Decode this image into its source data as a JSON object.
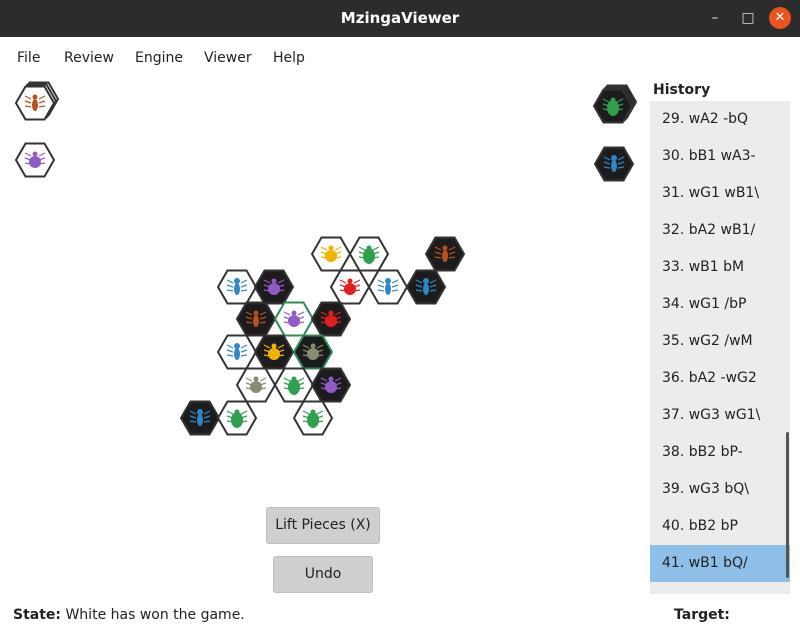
{
  "window": {
    "title": "MzingaViewer",
    "minimize": "–",
    "maximize": "□",
    "close": "✕"
  },
  "menu": [
    "File",
    "Review",
    "Engine",
    "Viewer",
    "Help"
  ],
  "history": {
    "title": "History",
    "moves": [
      "29. wA2 -bQ",
      "30. bB1 wA3-",
      "31. wG1 wB1\\",
      "32. bA2 wB1/",
      "33. wB1 bM",
      "34. wG1 /bP",
      "35. wG2 /wM",
      "36. bA2 -wG2",
      "37. wG3 wG1\\",
      "38. bB2 bP-",
      "39. wG3 bQ\\",
      "40. bB2 bP",
      "41. wB1 bQ/"
    ],
    "selected_index": 12
  },
  "buttons": {
    "lift_pieces": "Lift Pieces (X)",
    "undo": "Undo"
  },
  "status": {
    "state_label": "State:",
    "state_value": "White has won the game.",
    "target_label": "Target:"
  },
  "pieces": {
    "colors": {
      "spider": "#b5521e",
      "beetle": "#8f5bc7",
      "ant": "#2e88c8",
      "grasshopper": "#2fa04e",
      "queen": "#f0b400",
      "ladybug": "#e02020",
      "mosquito": "#8a8a70",
      "pillbug": "#8f5bc7"
    },
    "tile_colors": {
      "white": "#ffffff",
      "black": "#1c1c1c"
    },
    "last_move_outline": "#2e8b57",
    "hand_white": [
      {
        "bug": "spider",
        "color": "white",
        "stacked": true
      },
      {
        "bug": "beetle",
        "color": "white",
        "stacked": false
      }
    ],
    "hand_black": [
      {
        "bug": "grasshopper",
        "color": "black",
        "stacked": true
      },
      {
        "bug": "ant",
        "color": "black",
        "stacked": false
      }
    ],
    "board": [
      {
        "bug": "queen",
        "color": "white"
      },
      {
        "bug": "grasshopper",
        "color": "white"
      },
      {
        "bug": "spider",
        "color": "black"
      },
      {
        "bug": "ant",
        "color": "white"
      },
      {
        "bug": "beetle",
        "color": "black"
      },
      {
        "bug": "ladybug",
        "color": "white"
      },
      {
        "bug": "ant",
        "color": "white"
      },
      {
        "bug": "ant",
        "color": "black"
      },
      {
        "bug": "spider",
        "color": "black"
      },
      {
        "bug": "pillbug",
        "color": "white"
      },
      {
        "bug": "ladybug",
        "color": "black"
      },
      {
        "bug": "ant",
        "color": "white"
      },
      {
        "bug": "queen",
        "color": "black"
      },
      {
        "bug": "mosquito",
        "color": "black"
      },
      {
        "bug": "mosquito",
        "color": "white"
      },
      {
        "bug": "grasshopper",
        "color": "white"
      },
      {
        "bug": "beetle",
        "color": "black"
      },
      {
        "bug": "ant",
        "color": "black"
      },
      {
        "bug": "grasshopper",
        "color": "white"
      },
      {
        "bug": "grasshopper",
        "color": "white"
      }
    ]
  }
}
